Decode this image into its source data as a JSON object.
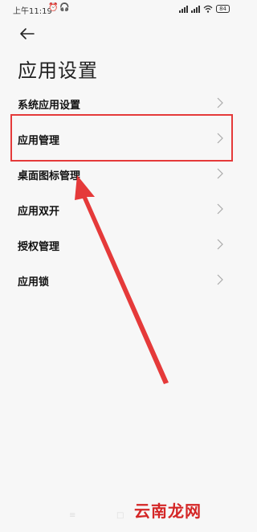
{
  "status_bar": {
    "time": "上午11:19",
    "battery": "84",
    "alarm_icon": "alarm-clock-icon",
    "headset_icon": "headset-icon"
  },
  "header": {
    "back_icon": "back-arrow-icon",
    "title": "应用设置"
  },
  "menu": {
    "items": [
      {
        "label": "系统应用设置"
      },
      {
        "label": "应用管理"
      },
      {
        "label": "桌面图标管理"
      },
      {
        "label": "应用双开"
      },
      {
        "label": "授权管理"
      },
      {
        "label": "应用锁"
      }
    ]
  },
  "annotation": {
    "highlight_color": "#e53a3a",
    "arrow_color": "#e53a3a"
  },
  "watermark": {
    "text": "云南龙网",
    "color": "#d42626"
  }
}
